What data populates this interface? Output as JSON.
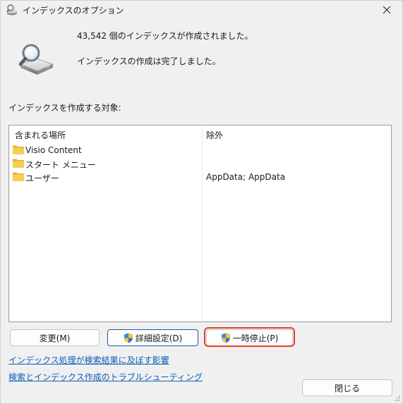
{
  "window": {
    "title": "インデックスのオプション"
  },
  "status": {
    "count_line": "43,542 個のインデックスが作成されました。",
    "state_line": "インデックスの作成は完了しました。"
  },
  "list": {
    "section_label": "インデックスを作成する対象:",
    "columns": {
      "included": "含まれる場所",
      "excluded": "除外"
    },
    "rows": [
      {
        "name": "Visio Content",
        "excluded": ""
      },
      {
        "name": "スタート メニュー",
        "excluded": ""
      },
      {
        "name": "ユーザー",
        "excluded": "AppData; AppData"
      }
    ]
  },
  "buttons": {
    "modify": "変更(M)",
    "advanced": "詳細設定(D)",
    "pause": "一時停止(P)",
    "close": "閉じる"
  },
  "links": {
    "impact": "インデックス処理が検索結果に及ぼす影響",
    "troubleshoot": "検索とインデックス作成のトラブルシューティング"
  },
  "colors": {
    "background": "#f0f0f0",
    "link": "#0a5fb4",
    "folder": "#f2c13a",
    "highlight": "#e0442f",
    "primary_border": "#1f5c96"
  },
  "icons": {
    "title": "search-drive-icon",
    "header": "magnifier-drive-icon",
    "folder": "folder-icon",
    "shield": "uac-shield-icon",
    "close": "close-icon"
  }
}
